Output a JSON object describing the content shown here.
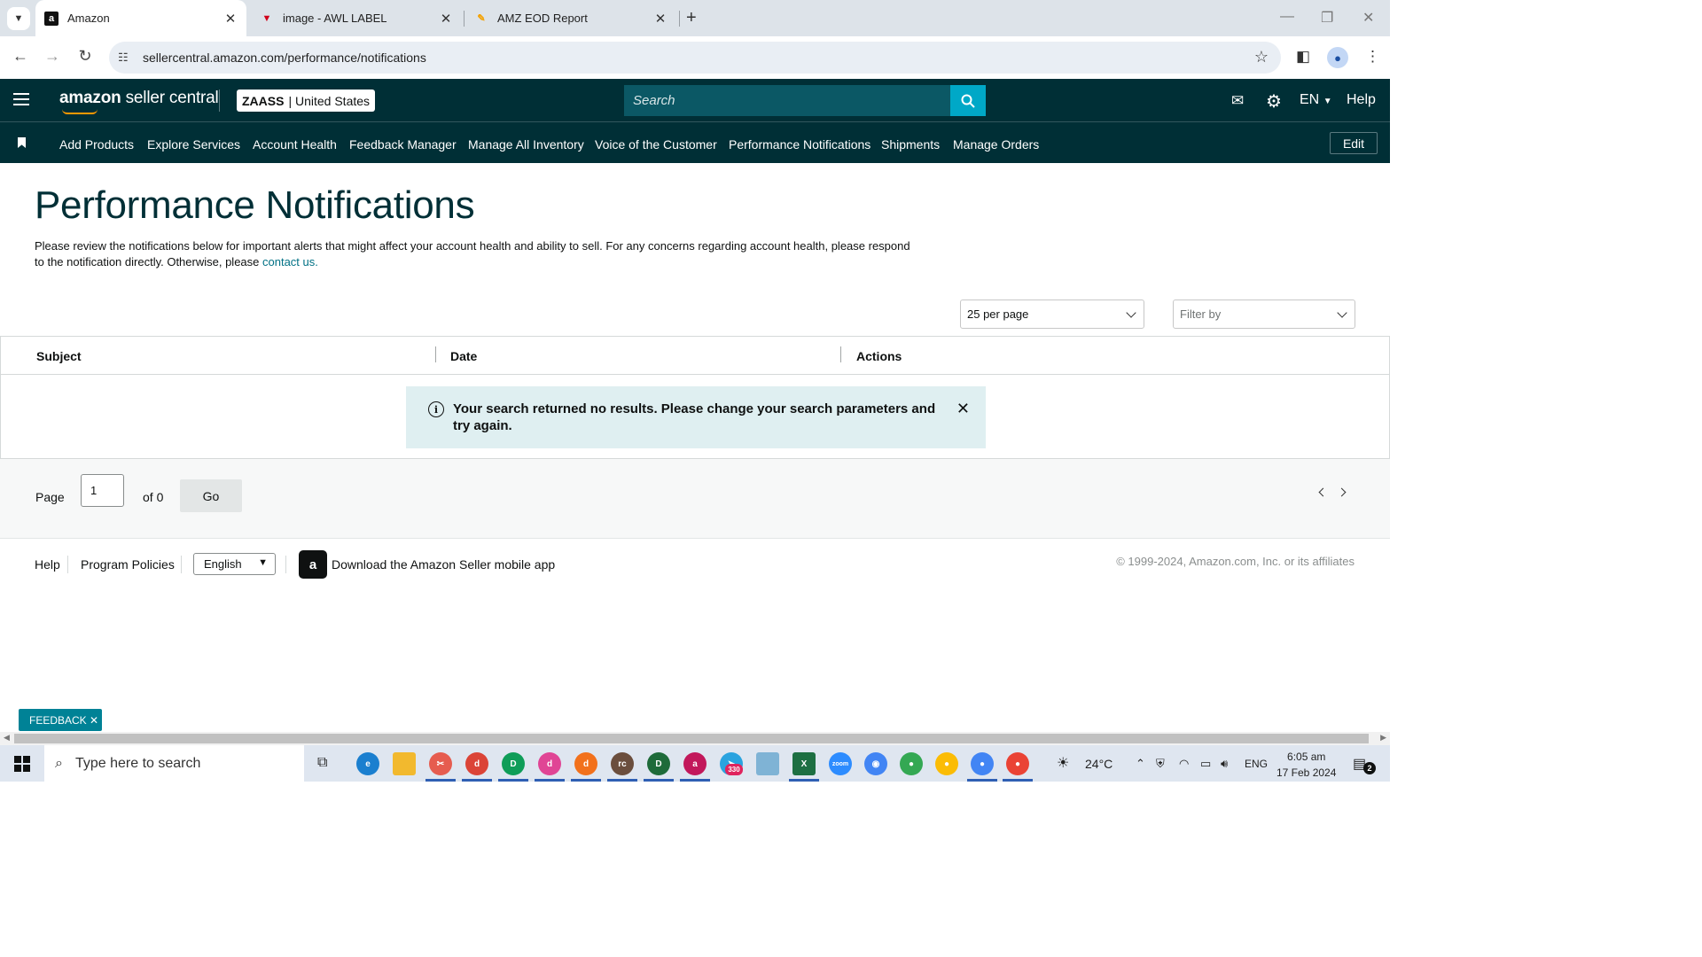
{
  "browser": {
    "tabs": [
      {
        "title": "Amazon",
        "favicon": "amazon-a-icon",
        "active": true
      },
      {
        "title": "image - AWL LABEL",
        "favicon": "awl-label-icon",
        "active": false
      },
      {
        "title": "AMZ EOD Report",
        "favicon": "eod-report-icon",
        "active": false
      }
    ],
    "url": "sellercentral.amazon.com/performance/notifications"
  },
  "header": {
    "brand_bold": "amazon",
    "brand_rest": " seller central",
    "store_name": "ZAASS",
    "store_region": "| United States",
    "search_placeholder": "Search",
    "lang": "EN",
    "help": "Help"
  },
  "nav": {
    "items": [
      "Add Products",
      "Explore Services",
      "Account Health",
      "Feedback Manager",
      "Manage All Inventory",
      "Voice of the Customer",
      "Performance Notifications",
      "Shipments",
      "Manage Orders"
    ],
    "edit": "Edit"
  },
  "main": {
    "title": "Performance Notifications",
    "description": "Please review the notifications below for important alerts that might affect your account health and ability to sell. For any concerns regarding account health, please respond to the notification directly. Otherwise, please ",
    "contact_link": "contact us.",
    "per_page": "25 per page",
    "filter_placeholder": "Filter by",
    "columns": [
      "Subject",
      "Date",
      "Actions"
    ],
    "alert": "Your search returned no results. Please change your search parameters and try again.",
    "pager": {
      "page_label": "Page",
      "page_value": "1",
      "of_label": "of 0",
      "go": "Go"
    }
  },
  "footer": {
    "help": "Help",
    "policies": "Program Policies",
    "language": "English",
    "app_text": "Download the Amazon Seller mobile app",
    "copyright": "© 1999-2024, Amazon.com, Inc. or its affiliates",
    "feedback": "FEEDBACK ✕"
  },
  "taskbar": {
    "search_placeholder": "Type here to search",
    "weather": "24°C",
    "lang": "ENG",
    "time": "6:05 am",
    "date": "17 Feb 2024",
    "notifications": "2",
    "telegram_badge": "330"
  },
  "colors": {
    "header_bg": "#002f36",
    "search_btn": "#00a8c7",
    "link": "#007185",
    "alert_bg": "#dfeff1"
  }
}
